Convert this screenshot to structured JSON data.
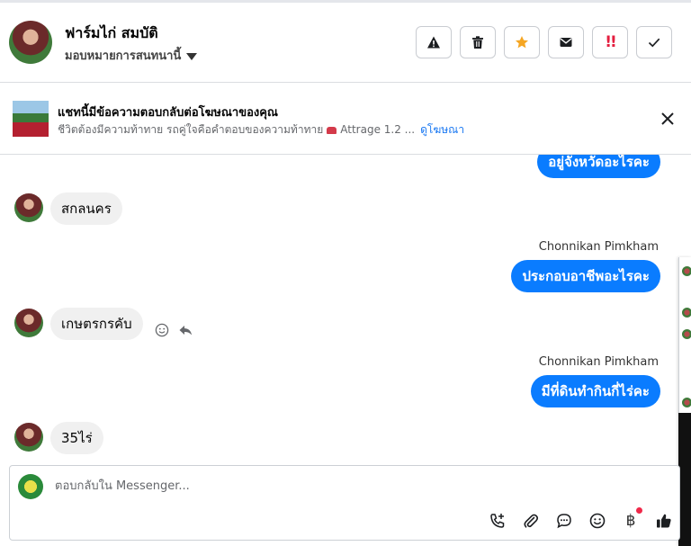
{
  "header": {
    "contact_name": "ฟาร์มไก่ สมบัติ",
    "assign_label": "มอบหมายการสนทนานี้",
    "actions": [
      {
        "name": "report-spam",
        "icon": "warning-icon"
      },
      {
        "name": "delete",
        "icon": "trash-icon"
      },
      {
        "name": "star",
        "icon": "star-icon",
        "color": "#f5a623"
      },
      {
        "name": "mark-unread",
        "icon": "envelope-icon"
      },
      {
        "name": "follow-up",
        "icon": "double-exclamation-icon",
        "label": "!!",
        "color": "#e41e3f"
      },
      {
        "name": "mark-done",
        "icon": "checkmark-icon"
      }
    ]
  },
  "ad_banner": {
    "title": "แชทนี้มีข้อความตอบกลับต่อโฆษณาของคุณ",
    "subtitle": "ชีวิตต้องมีความท้าทาย รถคู่ใจคือคำตอบของความท้าทาย",
    "car_model": "Attrage 1.2 ...",
    "link": "ดูโฆษณา"
  },
  "messages": [
    {
      "direction": "out",
      "text": "อยู่จังหวัดอะไรคะ"
    },
    {
      "direction": "in",
      "text": "สกลนคร"
    },
    {
      "direction": "out",
      "sender": "Chonnikan Pimkham",
      "text": "ประกอบอาชีพอะไรคะ"
    },
    {
      "direction": "in",
      "text": "เกษตรกรคับ"
    },
    {
      "direction": "out",
      "sender": "Chonnikan Pimkham",
      "text": "มีที่ดินทำกินกี่ไร่คะ"
    },
    {
      "direction": "in",
      "text": "35ไร่"
    }
  ],
  "composer": {
    "placeholder": "ตอบกลับใน Messenger...",
    "tools": [
      "call-add-icon",
      "paperclip-icon",
      "chat-bubble-icon",
      "emoji-icon",
      "baht-icon",
      "thumbs-up-icon"
    ],
    "baht_symbol": "฿"
  },
  "colors": {
    "outgoing_bubble": "#0a7cff",
    "incoming_bubble": "#f0f0f0",
    "link": "#1877f2"
  }
}
